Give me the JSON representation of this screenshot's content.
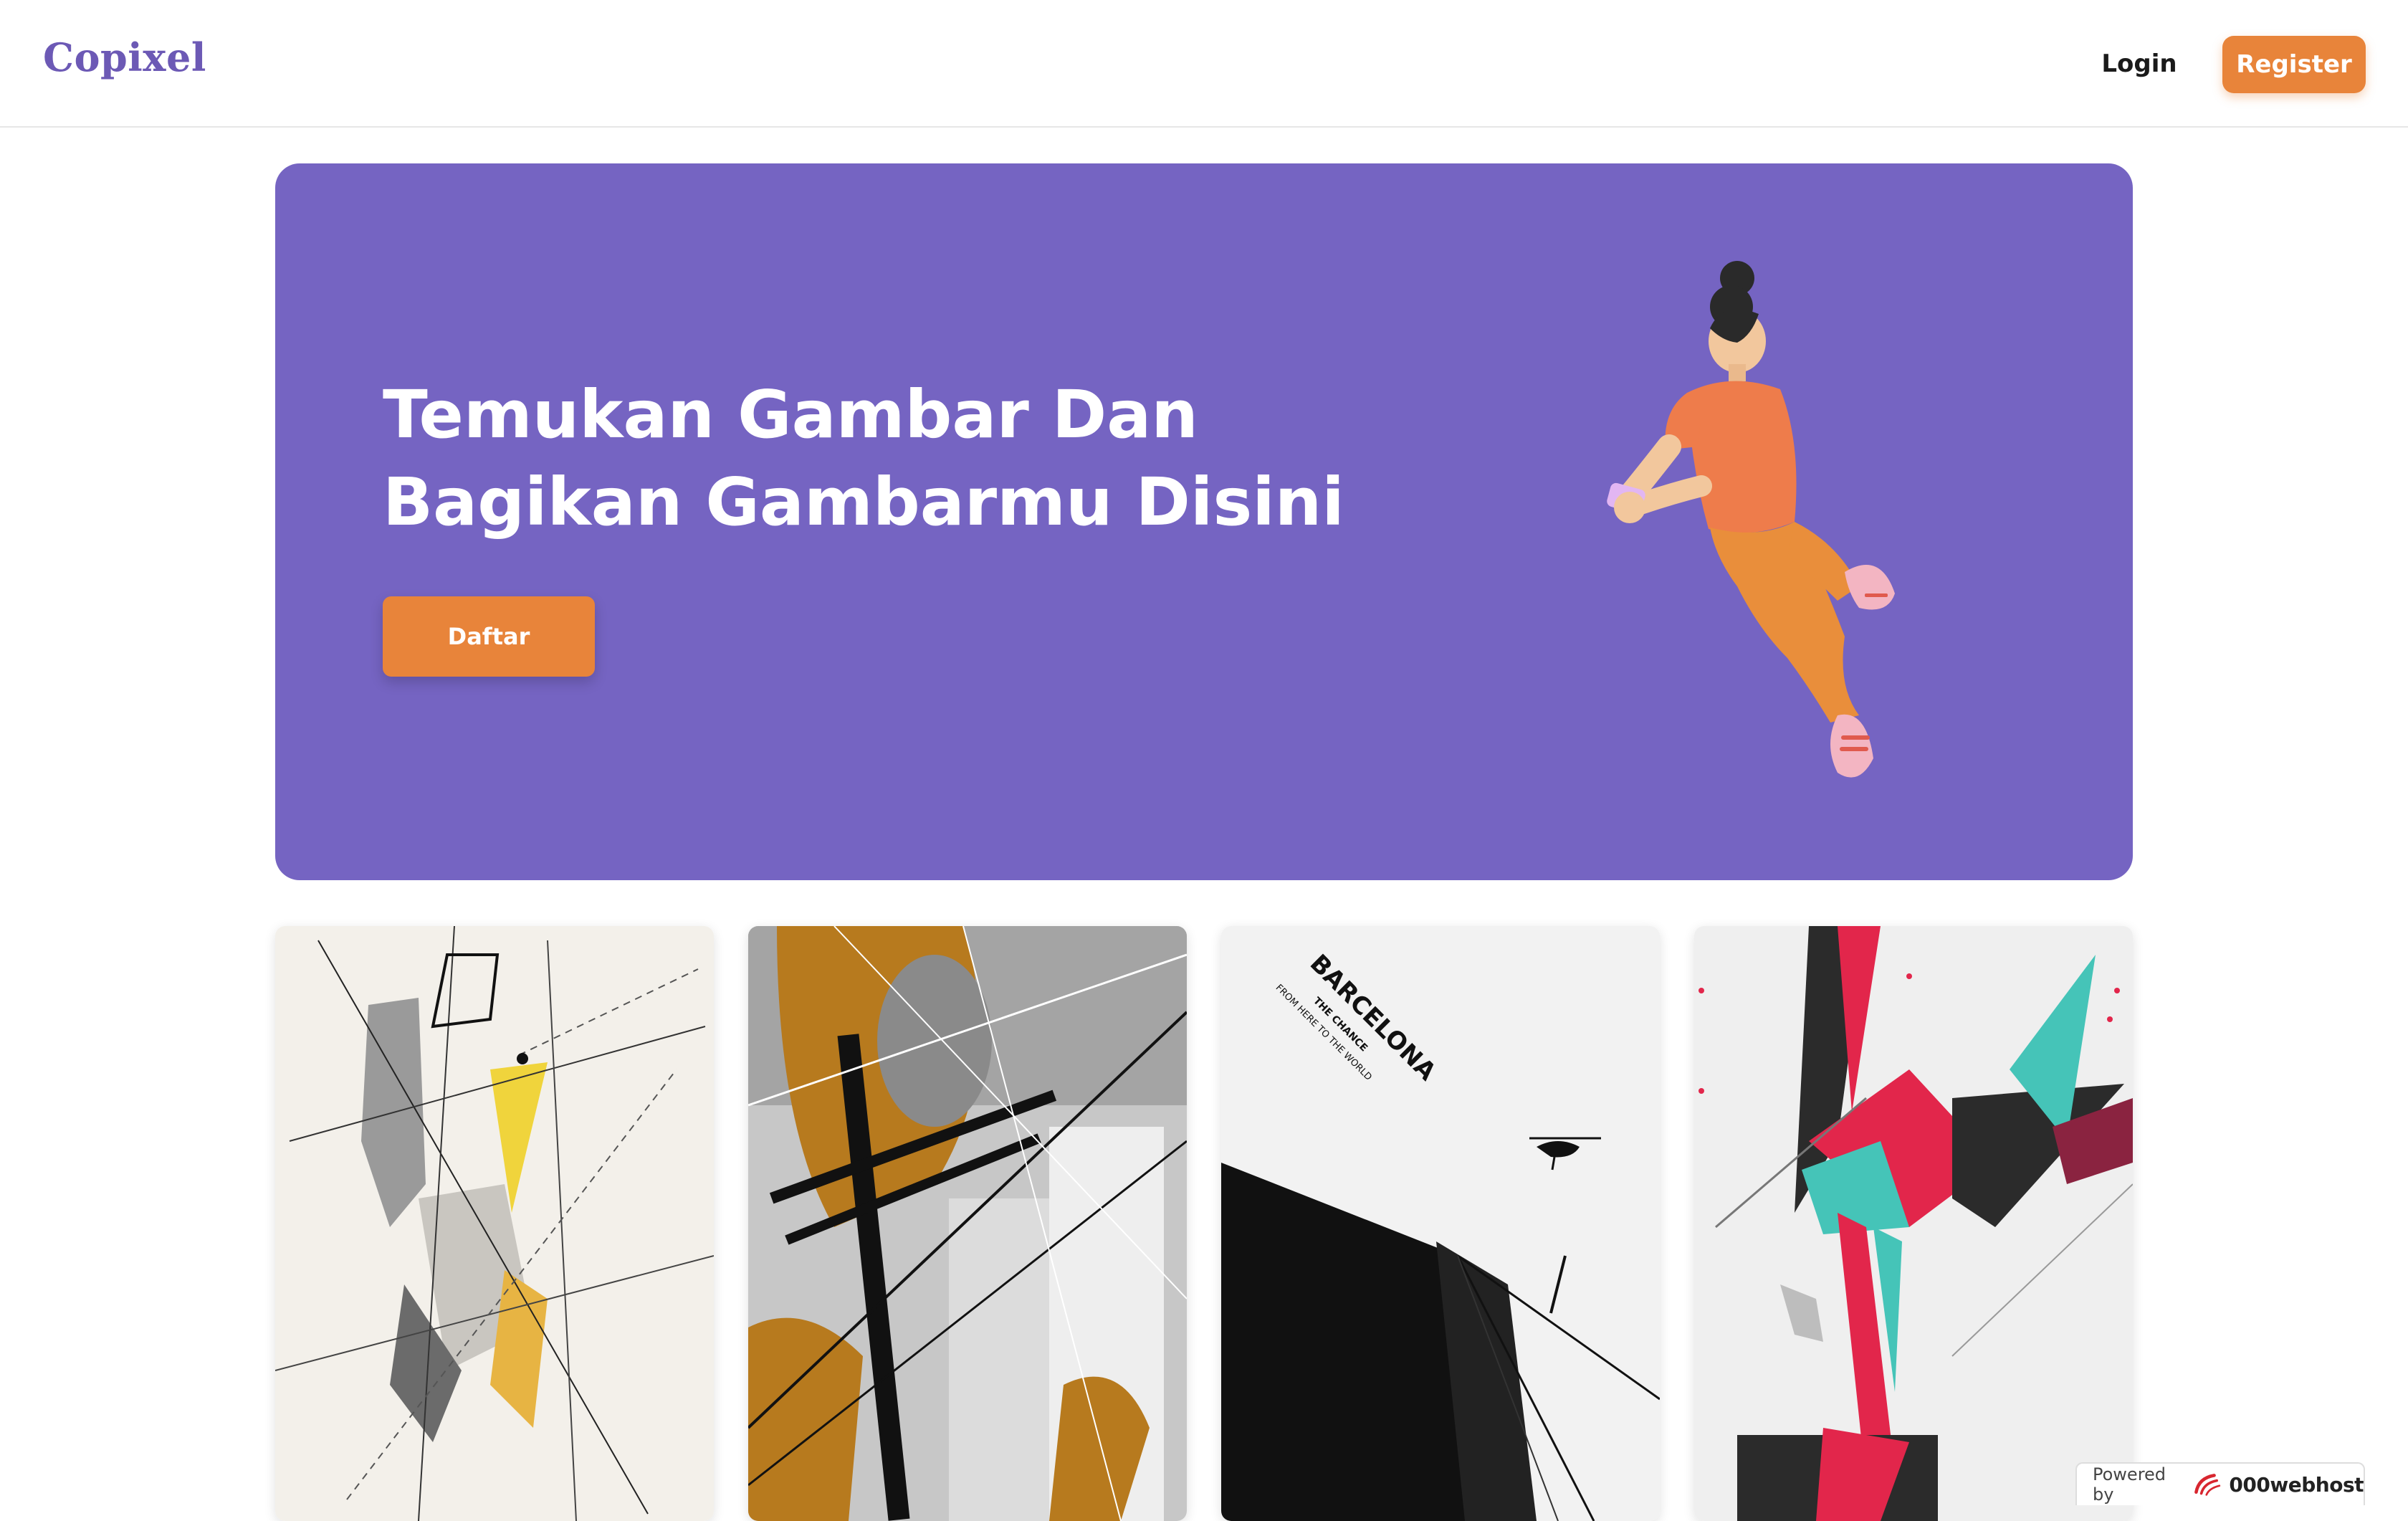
{
  "navbar": {
    "brand": "Copixel",
    "login_label": "Login",
    "register_label": "Register"
  },
  "hero": {
    "title_line1": "Temukan Gambar Dan",
    "title_line2": "Bagikan Gambarmu Disini",
    "cta_label": "Daftar",
    "illustration": "woman-holding-phone-illustration"
  },
  "gallery": {
    "items": [
      {
        "art": "abstract-geometric-sketch"
      },
      {
        "art": "urban-power-lines-collage"
      },
      {
        "art": "barcelona-poster",
        "text_main": "BARCELONA",
        "text_sub": "THE CHANCE",
        "text_small": "FROM HERE TO THE WORLD"
      },
      {
        "art": "abstract-splash-art"
      }
    ]
  },
  "footer_badge": {
    "label": "Powered by",
    "brand": "000webhost"
  },
  "colors": {
    "brand": "#6c59b5",
    "hero_bg": "#7564c2",
    "accent": "#e8843a"
  }
}
